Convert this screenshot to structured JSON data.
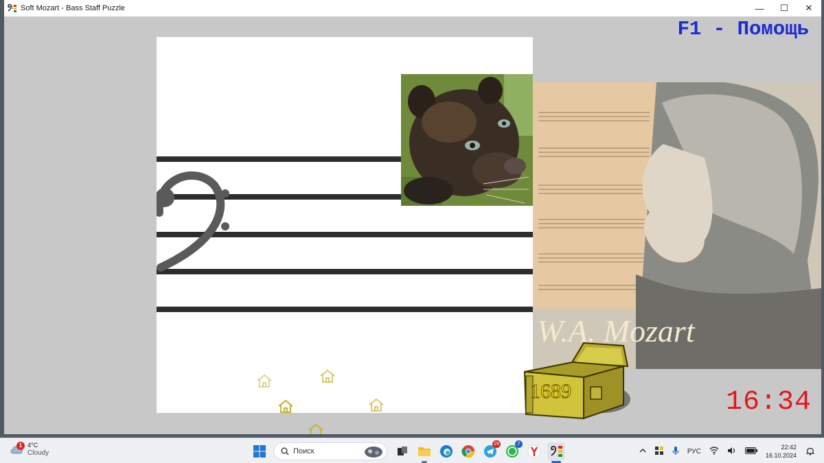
{
  "window": {
    "title": "Soft Mozart - Bass Staff Puzzle",
    "minimize": "—",
    "maximize": "☐",
    "close": "✕"
  },
  "game": {
    "help_text": "F1 - Помощь",
    "timer": "16:34",
    "score": "1689",
    "portrait_caption": "W.A. Mozart",
    "staff_lines": 5
  },
  "taskbar": {
    "weather_temp": "4°C",
    "weather_desc": "Cloudy",
    "weather_badge": "1",
    "search_label": "Поиск",
    "telegram_badge": "29",
    "whatsapp_badge": "7",
    "language": "РУС",
    "time": "22:42",
    "date": "16.10.2024"
  },
  "colors": {
    "help": "#1b2bd6",
    "timer": "#e8141a",
    "score": "#ffe21c",
    "chest": "#c9bd33"
  }
}
